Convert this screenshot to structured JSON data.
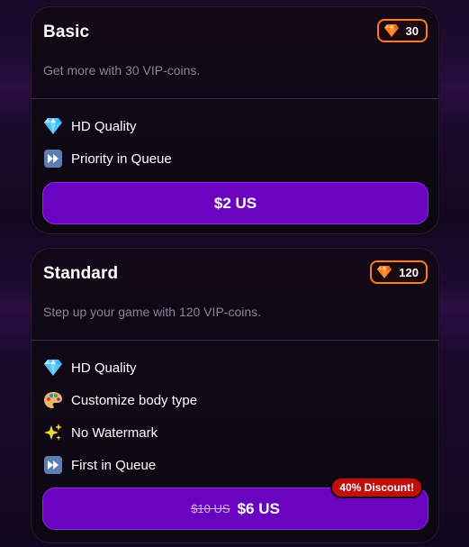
{
  "plans": [
    {
      "title": "Basic",
      "coins": "30",
      "subtitle": "Get more with 30 VIP-coins.",
      "features": [
        {
          "icon": "diamond-icon",
          "label": "HD Quality"
        },
        {
          "icon": "fast-forward-icon",
          "label": "Priority in Queue"
        }
      ],
      "price": "$2 US"
    },
    {
      "title": "Standard",
      "coins": "120",
      "subtitle": "Step up your game with 120 VIP-coins.",
      "features": [
        {
          "icon": "diamond-icon",
          "label": "HD Quality"
        },
        {
          "icon": "palette-icon",
          "label": "Customize body type"
        },
        {
          "icon": "sparkles-icon",
          "label": "No Watermark"
        },
        {
          "icon": "fast-forward-icon",
          "label": "First in Queue"
        }
      ],
      "old_price": "$10 US",
      "price": "$6 US",
      "discount": "40% Discount!"
    }
  ],
  "colors": {
    "accent_purple": "#6b04c1",
    "coin_border": "#ff7a1a",
    "discount_red": "#c20d0d"
  }
}
